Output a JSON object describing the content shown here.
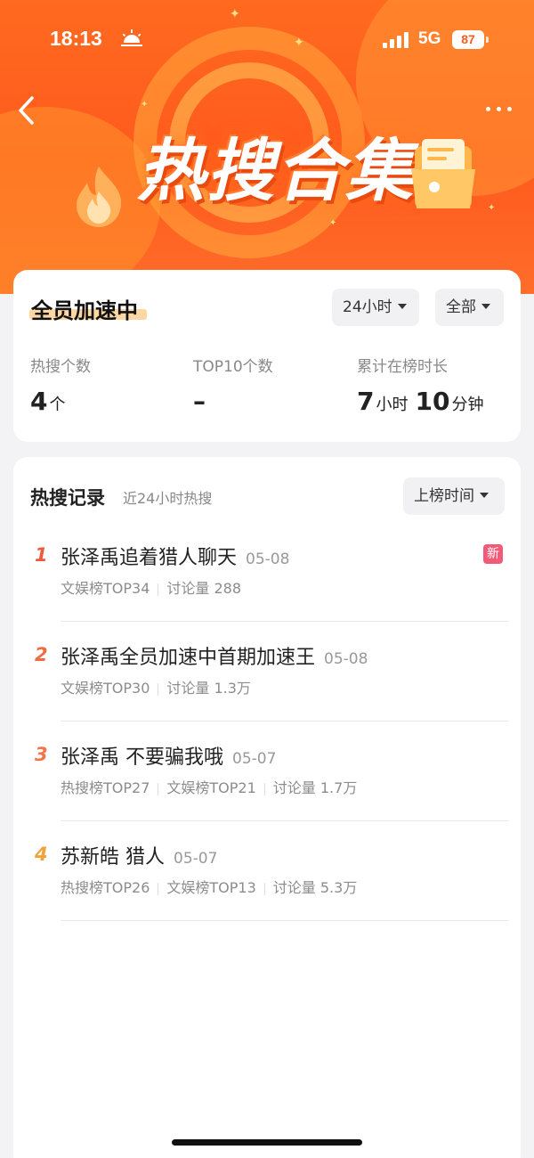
{
  "status_bar": {
    "time": "18:13",
    "network": "5G",
    "battery": "87"
  },
  "header": {
    "title": "热搜合集",
    "back_icon": "chevron-left-icon",
    "more_icon": "more-dots-icon"
  },
  "summary": {
    "title": "全员加速中",
    "time_filter": "24小时",
    "scope_filter": "全部",
    "stats": [
      {
        "label": "热搜个数",
        "value": "4",
        "unit": "个"
      },
      {
        "label": "TOP10个数",
        "value": "–",
        "unit": ""
      },
      {
        "label": "累计在榜时长",
        "hours": "7",
        "hours_unit": "小时",
        "minutes": "10",
        "minutes_unit": "分钟"
      }
    ]
  },
  "records": {
    "title": "热搜记录",
    "subtitle": "近24小时热搜",
    "sort_label": "上榜时间",
    "items": [
      {
        "rank": "1",
        "title": "张泽禹追着猎人聊天",
        "date": "05-08",
        "badge": "新",
        "meta": [
          "文娱榜TOP34",
          "讨论量 288"
        ],
        "rank_color": "#f05a3c"
      },
      {
        "rank": "2",
        "title": "张泽禹全员加速中首期加速王",
        "date": "05-08",
        "meta": [
          "文娱榜TOP30",
          "讨论量 1.3万"
        ],
        "rank_color": "#f06a44"
      },
      {
        "rank": "3",
        "title": "张泽禹 不要骗我哦",
        "date": "05-07",
        "meta": [
          "热搜榜TOP27",
          "文娱榜TOP21",
          "讨论量 1.7万"
        ],
        "rank_color": "#f2764a"
      },
      {
        "rank": "4",
        "title": "苏新皓 猎人",
        "date": "05-07",
        "meta": [
          "热搜榜TOP26",
          "文娱榜TOP13",
          "讨论量 5.3万"
        ],
        "rank_color": "#f2a23a"
      }
    ]
  }
}
